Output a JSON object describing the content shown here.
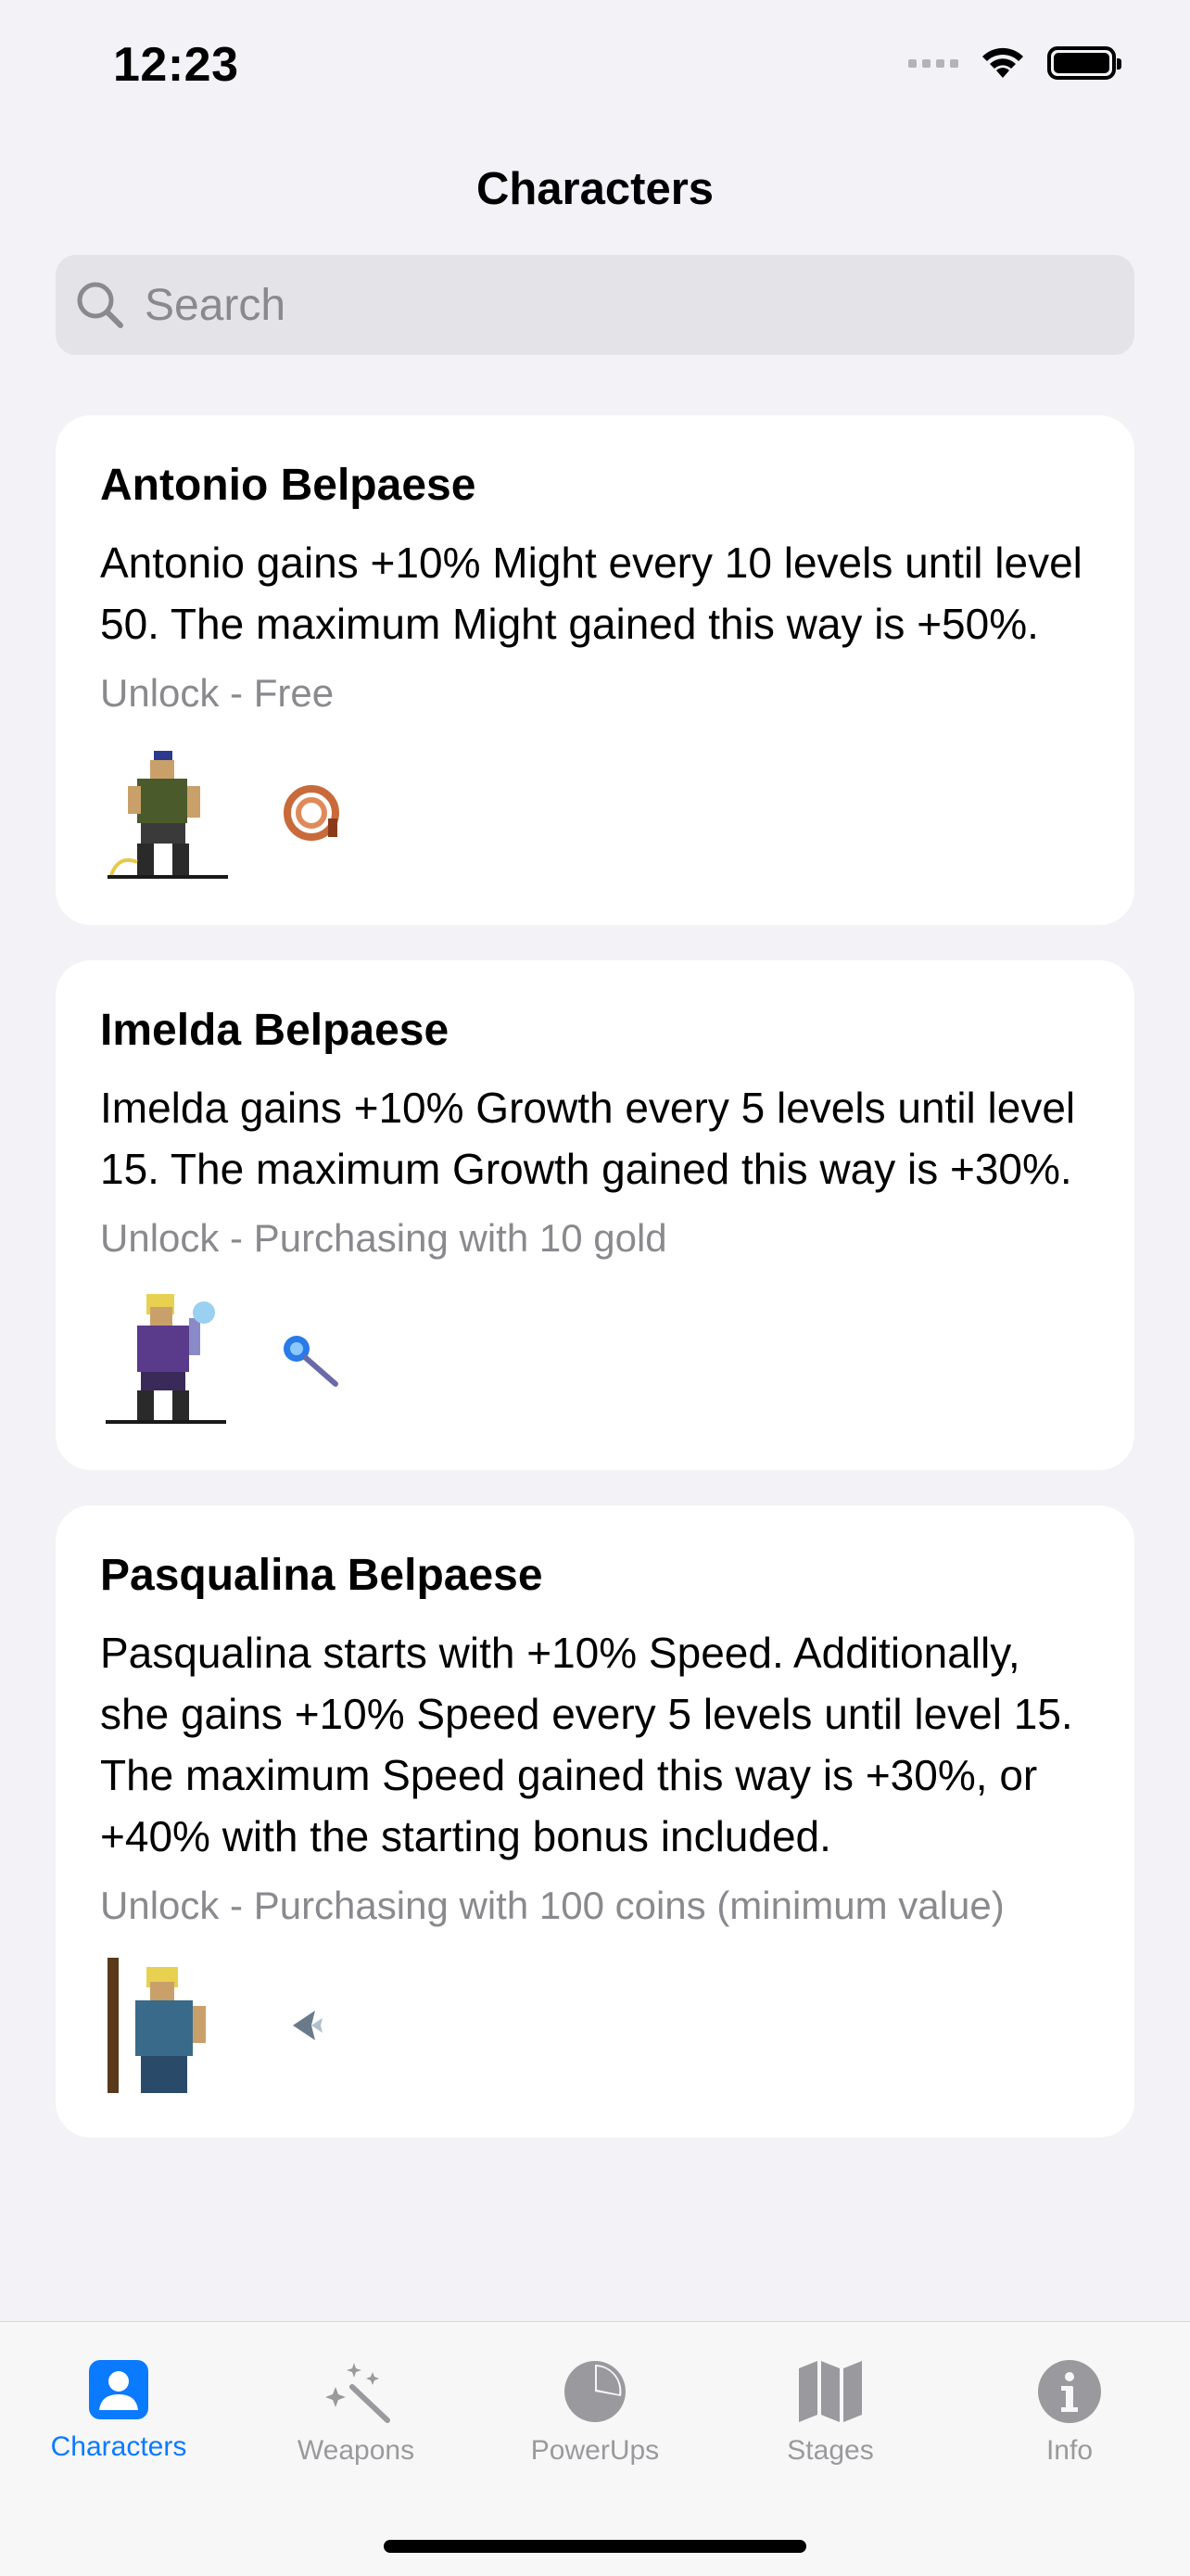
{
  "status_bar": {
    "time": "12:23"
  },
  "nav": {
    "title": "Characters"
  },
  "search": {
    "placeholder": "Search",
    "value": ""
  },
  "characters": [
    {
      "name": "Antonio Belpaese",
      "description": "Antonio gains +10% Might every 10 levels until level 50. The maximum Might gained this way is +50%.",
      "unlock": "Unlock - Free",
      "sprite": "antonio-sprite",
      "weapon_icon": "whip-icon"
    },
    {
      "name": "Imelda Belpaese",
      "description": "Imelda gains +10% Growth every 5 levels until level 15. The maximum Growth gained this way is +30%.",
      "unlock": "Unlock - Purchasing with 10 gold",
      "sprite": "imelda-sprite",
      "weapon_icon": "magic-wand-icon"
    },
    {
      "name": "Pasqualina Belpaese",
      "description": "Pasqualina starts with +10% Speed. Additionally, she gains +10% Speed every 5 levels until level 15. The maximum Speed gained this way is +30%, or +40% with the starting bonus included.",
      "unlock": "Unlock - Purchasing with 100 coins (minimum value)",
      "sprite": "pasqualina-sprite",
      "weapon_icon": "runetracer-icon"
    }
  ],
  "tabs": [
    {
      "label": "Characters",
      "icon": "person-icon",
      "active": true
    },
    {
      "label": "Weapons",
      "icon": "wand-sparkles-icon",
      "active": false
    },
    {
      "label": "PowerUps",
      "icon": "pie-chart-icon",
      "active": false
    },
    {
      "label": "Stages",
      "icon": "map-icon",
      "active": false
    },
    {
      "label": "Info",
      "icon": "info-icon",
      "active": false
    }
  ],
  "colors": {
    "accent": "#0A7AFF",
    "inactive": "#9A9A9E",
    "background": "#F2F2F7"
  }
}
